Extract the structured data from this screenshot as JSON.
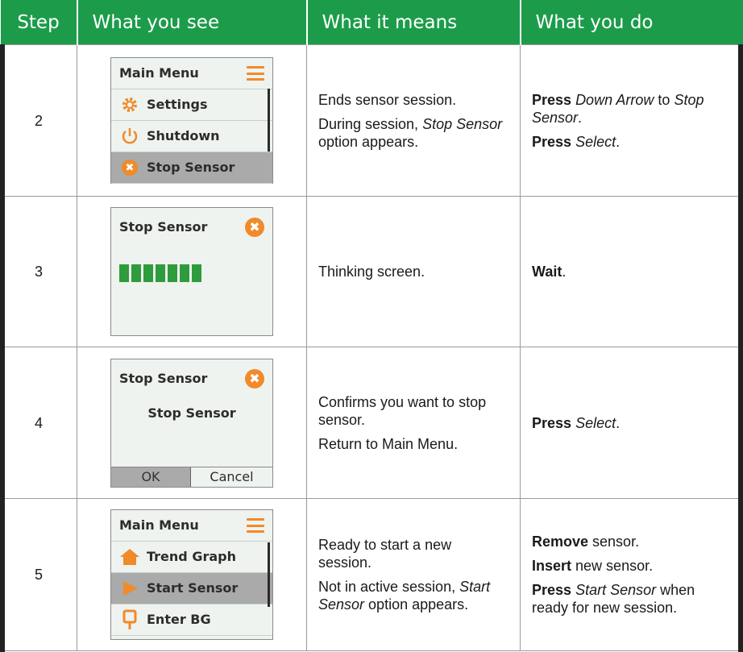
{
  "header": {
    "step": "Step",
    "see": "What you see",
    "means": "What it means",
    "do": "What you do"
  },
  "rows": [
    {
      "step": "2",
      "screen": {
        "title": "Main Menu",
        "items": [
          {
            "label": "Settings",
            "icon": "gear-icon"
          },
          {
            "label": "Shutdown",
            "icon": "power-icon"
          },
          {
            "label": "Stop Sensor",
            "icon": "x-circle-icon",
            "selected": true
          }
        ]
      },
      "means": [
        "Ends sensor session.",
        "During session, ",
        "Stop Sensor",
        " option appears."
      ],
      "do": [
        "Press",
        " ",
        "Down Arrow",
        " to ",
        "Stop Sensor",
        ".",
        "Press",
        " ",
        "Select",
        "."
      ]
    },
    {
      "step": "3",
      "screen": {
        "title": "Stop Sensor",
        "progress_segments": 7
      },
      "means": [
        "Thinking screen."
      ],
      "do": [
        "Wait",
        "."
      ]
    },
    {
      "step": "4",
      "screen": {
        "title": "Stop Sensor",
        "message": "Stop Sensor",
        "ok": "OK",
        "cancel": "Cancel"
      },
      "means": [
        "Confirms you want to stop sensor.",
        "Return to Main Menu."
      ],
      "do": [
        "Press",
        " ",
        "Select",
        "."
      ]
    },
    {
      "step": "5",
      "screen": {
        "title": "Main Menu",
        "items": [
          {
            "label": "Trend Graph",
            "icon": "home-icon"
          },
          {
            "label": "Start Sensor",
            "icon": "play-icon",
            "selected": true
          },
          {
            "label": "Enter BG",
            "icon": "meter-icon"
          }
        ]
      },
      "means": [
        "Ready to start a new session.",
        "Not in active session, ",
        "Start Sensor",
        " option appears."
      ],
      "do": [
        "Remove",
        " sensor.",
        "Insert",
        " new sensor.",
        "Press",
        " ",
        "Start Sensor",
        " when ready for new session."
      ]
    }
  ],
  "colors": {
    "header_bg": "#1c9c4a",
    "accent_orange": "#f08a2a",
    "progress_green": "#2e9b3c"
  }
}
